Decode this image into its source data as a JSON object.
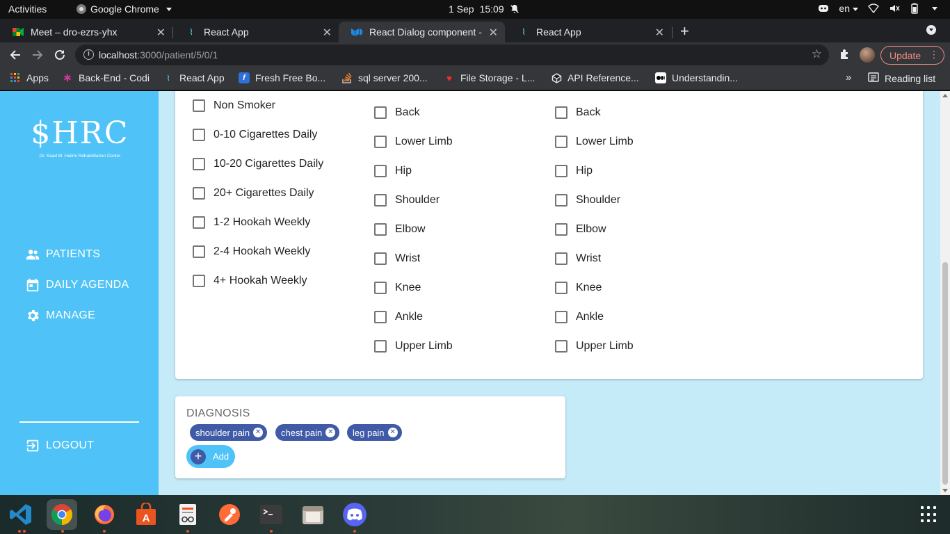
{
  "system_bar": {
    "activities": "Activities",
    "app_name": "Google Chrome",
    "date": "1 Sep",
    "time": "15:09",
    "language": "en"
  },
  "tabs": [
    {
      "title": "Meet – dro-ezrs-yhx",
      "icon": "meet-icon"
    },
    {
      "title": "React App",
      "icon": "react-icon"
    },
    {
      "title": "React Dialog component - ",
      "icon": "mui-icon"
    },
    {
      "title": "React App",
      "icon": "react-icon"
    }
  ],
  "address_bar": {
    "host": "localhost",
    "path": ":3000/patient/5/0/1"
  },
  "update_label": "Update",
  "bookmarks": [
    {
      "label": "Apps"
    },
    {
      "label": "Back-End - Codi"
    },
    {
      "label": "React App"
    },
    {
      "label": "Fresh Free Bo..."
    },
    {
      "label": "sql server 200..."
    },
    {
      "label": "File Storage - L..."
    },
    {
      "label": "API Reference..."
    },
    {
      "label": "Understandin..."
    }
  ],
  "reading_list": "Reading list",
  "sidebar": {
    "logo_text": "$HRC",
    "logo_subtitle": "Dr. Saad M. Halimi Rehabilitation Center",
    "nav": [
      {
        "label": "PATIENTS",
        "icon": "people-icon"
      },
      {
        "label": "DAILY AGENDA",
        "icon": "calendar-icon"
      },
      {
        "label": "MANAGE",
        "icon": "gear-icon"
      }
    ],
    "logout": "LOGOUT"
  },
  "smoking_options": [
    "Non Smoker",
    "0-10 Cigarettes Daily",
    "10-20 Cigarettes Daily",
    "20+ Cigarettes Daily",
    "1-2 Hookah Weekly",
    "2-4 Hookah Weekly",
    "4+ Hookah Weekly"
  ],
  "body_parts_a": [
    "Back",
    "Lower Limb",
    "Hip",
    "Shoulder",
    "Elbow",
    "Wrist",
    "Knee",
    "Ankle",
    "Upper Limb"
  ],
  "body_parts_b": [
    "Back",
    "Lower Limb",
    "Hip",
    "Shoulder",
    "Elbow",
    "Wrist",
    "Knee",
    "Ankle",
    "Upper Limb"
  ],
  "diagnosis": {
    "title": "DIAGNOSIS",
    "chips": [
      "shoulder pain",
      "chest pain",
      "leg pain"
    ],
    "add_label": "Add"
  }
}
